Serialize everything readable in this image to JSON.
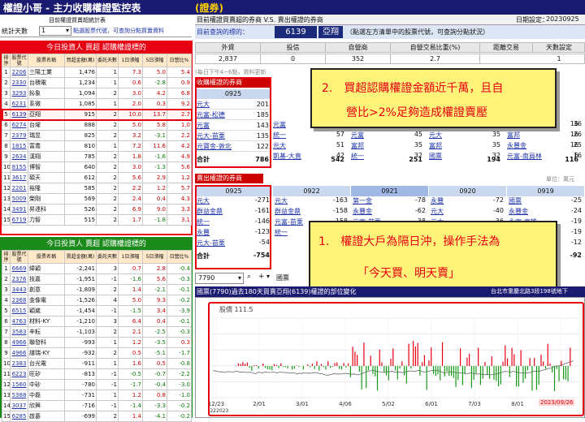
{
  "header": {
    "title": "權證小哥 - 主力收購權證監控表",
    "badge": "(證券)",
    "subtitle": "目前權證買賣超統計表",
    "stats_label": "統計天數",
    "days": "1",
    "hint": "點選股票代號，可查詢分點買賣資料"
  },
  "right_header": {
    "title": "目前權證買賣超的券商 V.S. 賣出權證的券商",
    "date_label": "日期設定：",
    "date": "20230925",
    "query_label": "目前查詢的標的：",
    "stock_code": "6139",
    "stock_name": "亞翔",
    "query_hint": "（點選左方清單中的股票代號，可查詢分點狀況）"
  },
  "summary": {
    "headers": [
      "外資",
      "投信",
      "自營商",
      "自營交易比重(%)",
      "距離交易",
      "天數設定"
    ],
    "values": [
      "2,837",
      "0",
      "352",
      "2.7",
      "",
      "1"
    ]
  },
  "buy_section": {
    "title": "今日投資人 買超 認購權證標的",
    "cols": [
      "排序",
      "股票代號",
      "股票名稱",
      "買超金額(萬)",
      "委託天數",
      "1日漲幅",
      "5日漲幅",
      "日營比%"
    ],
    "rows": [
      [
        "1",
        "2206",
        "三陽工業",
        "1,476",
        "1",
        "7.3",
        "5.0",
        "5.4"
      ],
      [
        "2",
        "2330",
        "台積電",
        "1,234",
        "1",
        "0.6",
        "-2.8",
        "0.9"
      ],
      [
        "3",
        "3293",
        "鈊象",
        "1,094",
        "2",
        "3.0",
        "4.2",
        "6.8"
      ],
      [
        "4",
        "6231",
        "系微",
        "1,085",
        "1",
        "2.0",
        "0.3",
        "9.2"
      ],
      [
        "5",
        "6139",
        "亞翔",
        "915",
        "2",
        "10.0",
        "13.7",
        "2.7"
      ],
      [
        "6",
        "6274",
        "台燿",
        "888",
        "2",
        "5.0",
        "5.8",
        "1.0"
      ],
      [
        "7",
        "2379",
        "瑞昱",
        "825",
        "2",
        "3.2",
        "-3.1",
        "2.2"
      ],
      [
        "8",
        "1815",
        "富喬",
        "810",
        "1",
        "7.2",
        "11.6",
        "4.2"
      ],
      [
        "9",
        "2634",
        "漢翔",
        "785",
        "2",
        "1.8",
        "-1.6",
        "4.9"
      ],
      [
        "10",
        "8155",
        "博智",
        "640",
        "2",
        "3.0",
        "-1.3",
        "5.6"
      ],
      [
        "11",
        "3617",
        "碩天",
        "612",
        "2",
        "5.6",
        "2.9",
        "1.2"
      ],
      [
        "12",
        "2201",
        "裕隆",
        "585",
        "2",
        "2.2",
        "1.2",
        "5.7"
      ],
      [
        "13",
        "5009",
        "榮剛",
        "569",
        "2",
        "2.4",
        "0.4",
        "4.3"
      ],
      [
        "14",
        "3491",
        "昇達科",
        "526",
        "2",
        "6.9",
        "9.0",
        "3.3"
      ],
      [
        "15",
        "6719",
        "力智",
        "515",
        "2",
        "1.7",
        "-1.8",
        "3.1"
      ]
    ]
  },
  "sell_section": {
    "title": "今日投資人 賣超 認購權證標的",
    "cols": [
      "排序",
      "股票代號",
      "股票名稱",
      "賣超金額(萬)",
      "委託天數",
      "1日漲幅",
      "5日漲幅",
      "日營比%"
    ],
    "rows": [
      [
        "1",
        "6669",
        "緯穎",
        "-2,241",
        "3",
        "0.7",
        "2.8",
        "-0.4"
      ],
      [
        "2",
        "2376",
        "技嘉",
        "-1,951",
        "-1",
        "-1.6",
        "5.6",
        "-0.3"
      ],
      [
        "3",
        "3443",
        "創意",
        "-1,809",
        "2",
        "1.4",
        "-2.1",
        "-0.1"
      ],
      [
        "4",
        "2368",
        "金像電",
        "-1,526",
        "4",
        "5.0",
        "9.3",
        "-0.2"
      ],
      [
        "5",
        "6515",
        "穎崴",
        "-1,454",
        "-1",
        "-1.5",
        "3.4",
        "-3.9"
      ],
      [
        "6",
        "4763",
        "材料-KY",
        "-1,210",
        "3",
        "6.4",
        "0.4",
        "-0.1"
      ],
      [
        "7",
        "3583",
        "辛耘",
        "-1,103",
        "2",
        "2.1",
        "-2.5",
        "-0.3"
      ],
      [
        "8",
        "4966",
        "聯發科",
        "-993",
        "1",
        "1.2",
        "-3.5",
        "0.3"
      ],
      [
        "9",
        "4966",
        "譜瑞-KY",
        "-932",
        "2",
        "0.5",
        "-5.1",
        "-1.7"
      ],
      [
        "10",
        "2383",
        "台光電",
        "-911",
        "1",
        "1.6",
        "0.5",
        "-0.8"
      ],
      [
        "11",
        "6223",
        "旺矽",
        "-813",
        "-1",
        "-0.5",
        "-0.7",
        "-2.2"
      ],
      [
        "12",
        "1560",
        "中砂",
        "-780",
        "-1",
        "-1.7",
        "-0.4",
        "-3.0"
      ],
      [
        "13",
        "5388",
        "中磊",
        "-731",
        "1",
        "1.2",
        "0.8",
        "-1.0"
      ],
      [
        "14",
        "3037",
        "欣興",
        "-716",
        "-1",
        "-1.4",
        "-3.3",
        "-0.2"
      ],
      [
        "15",
        "6285",
        "啟碁",
        "-699",
        "2",
        "1.4",
        "-4.1",
        "-0.2"
      ]
    ]
  },
  "buy_brokers": {
    "title": "收購權證的券商",
    "date": "0925",
    "rows": [
      [
        "元大",
        "201"
      ],
      [
        "元富-松德",
        "185"
      ],
      [
        "元富",
        "143"
      ],
      [
        "元大-苗栗",
        "135"
      ],
      [
        "元寶金-敦北",
        "122"
      ]
    ],
    "total_label": "合計",
    "total": "786",
    "other_cols": [
      {
        "rows": [
          [
            "元富",
            "57"
          ],
          [
            "統一",
            "57"
          ],
          [
            "元大",
            "51"
          ],
          [
            "凱基-大直",
            "42"
          ]
        ],
        "total": "542"
      },
      {
        "rows": [
          [
            "元大",
            "47"
          ],
          [
            "元富",
            "45"
          ],
          [
            "富邦",
            "35"
          ],
          [
            "統一",
            "32"
          ]
        ],
        "total": "251"
      },
      {
        "rows": [
          [
            "元富",
            "39"
          ],
          [
            "元大",
            "35"
          ],
          [
            "富邦",
            "35"
          ],
          [
            "國票",
            "32"
          ]
        ],
        "total": "194"
      },
      {
        "rows": [
          [
            "元富-台北",
            "16"
          ],
          [
            "富邦",
            "16"
          ],
          [
            "永豐金",
            "16"
          ],
          [
            "元富-南員林",
            "6"
          ]
        ],
        "total": "116"
      }
    ],
    "right_vals": [
      "36",
      "26",
      "25",
      "16"
    ]
  },
  "sell_brokers": {
    "title": "賣出權證的券商",
    "unit": "單位：萬元",
    "dates": [
      "0925",
      "0922",
      "0921",
      "0920",
      "0919"
    ],
    "cols": [
      {
        "rows": [
          [
            "元大",
            "-271"
          ],
          [
            "群益金鼎",
            "-161"
          ],
          [
            "統一",
            "-146"
          ],
          [
            "永豐",
            "-123"
          ],
          [
            "元大-苗栗",
            "-54"
          ]
        ],
        "total": "-754"
      },
      {
        "rows": [
          [
            "元大",
            "-163"
          ],
          [
            "群益金鼎",
            "-158"
          ],
          [
            "元富-苗栗",
            "-158"
          ],
          [
            "統一",
            "-102"
          ],
          [
            "",
            "-66"
          ]
        ],
        "total": ""
      },
      {
        "rows": [
          [
            "第一金",
            "-78"
          ],
          [
            "永豐金",
            "-62"
          ],
          [
            "元富-苗栗",
            "-38"
          ],
          [
            "元大",
            "-14"
          ],
          [
            "",
            "-6"
          ]
        ],
        "total": ""
      },
      {
        "rows": [
          [
            "永豐",
            "-72"
          ],
          [
            "元大",
            "-40"
          ],
          [
            "元大",
            "-36"
          ],
          [
            "",
            "-24"
          ],
          [
            "",
            "-12"
          ]
        ],
        "total": ""
      },
      {
        "rows": [
          [
            "國票",
            "-25"
          ],
          [
            "永豐金",
            "-24"
          ],
          [
            "永富-高雄",
            "-19"
          ],
          [
            "",
            "-19"
          ],
          [
            "",
            "-12"
          ]
        ],
        "total": "-92"
      }
    ]
  },
  "callout1": {
    "line1": "2.　買超認購權證金額近千萬，且自",
    "line2": "營比>2%足夠造成權證賣壓"
  },
  "callout2": {
    "line1": "1.　權證大戶為隔日沖，操作手法為",
    "line2": "「今天買、明天賣」"
  },
  "chart_bar": {
    "code": "7790",
    "button": "國票"
  },
  "chart": {
    "title": "國票(7790)過去180天買賣亞翔(6139)權證的部位變化",
    "right_title": "台北市重慶北路3段198號地下",
    "price_label": "股價 111.5",
    "date_badge": "2023/09/26",
    "x_labels": [
      "12/23",
      "2/01",
      "3/01",
      "4/06",
      "5/02",
      "6/01",
      "7/03",
      "8/01",
      "9/01"
    ],
    "x_sub": [
      "2022",
      "2023"
    ]
  },
  "colors": {
    "red": "#e60012",
    "navy": "#1b2a7a",
    "callout_bg": "#fff37a",
    "buy_header": "#ffe3c4",
    "highlight": "#e60012"
  }
}
